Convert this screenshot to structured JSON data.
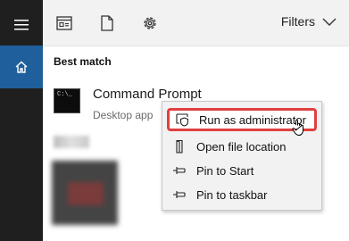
{
  "rail": {
    "menu_icon": "hamburger-icon",
    "home_icon": "home-icon",
    "home_active": true
  },
  "toolbar": {
    "icons": [
      "apps-icon",
      "documents-icon",
      "settings-icon"
    ],
    "filters_label": "Filters",
    "filters_icon": "chevron-down-icon"
  },
  "results": {
    "section_title": "Best match",
    "item": {
      "name": "Command Prompt",
      "type": "Desktop app",
      "icon": "command-prompt-icon",
      "icon_text": "C:\\_"
    }
  },
  "context_menu": {
    "items": [
      {
        "label": "Run as administrator",
        "icon": "shield-icon",
        "highlighted": true
      },
      {
        "label": "Open file location",
        "icon": "folder-location-icon"
      },
      {
        "label": "Pin to Start",
        "icon": "pin-icon"
      },
      {
        "label": "Pin to taskbar",
        "icon": "pin-icon"
      }
    ]
  },
  "colors": {
    "rail": "#1f1f1f",
    "home_active": "#1e5f9c",
    "highlight_border": "#e04040",
    "menu_bg": "#f2f2f2"
  }
}
